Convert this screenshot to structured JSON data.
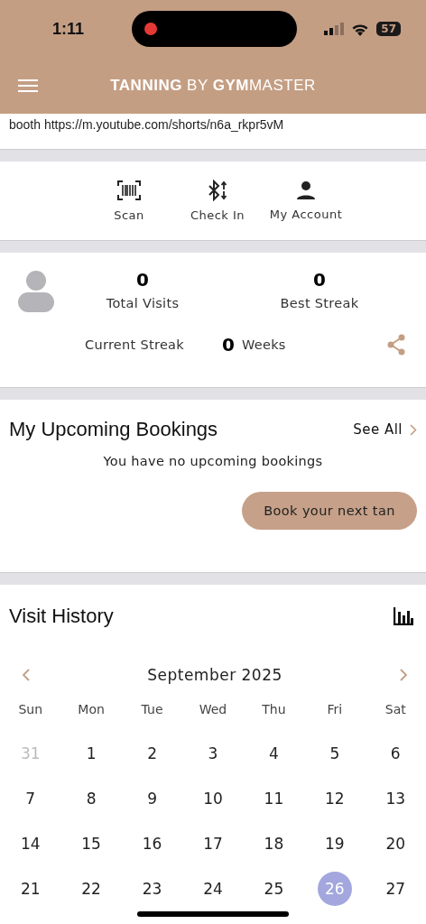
{
  "status_bar": {
    "time": "1:11",
    "battery": "57"
  },
  "header": {
    "title": "**TANNING** BY **GYM**MASTER"
  },
  "banner": {
    "text": "booth https://m.youtube.com/shorts/n6a_rkpr5vM"
  },
  "actions": [
    {
      "kind": "scan",
      "label": "Scan"
    },
    {
      "kind": "checkin",
      "label": "Check In"
    },
    {
      "kind": "account",
      "label": "My Account"
    }
  ],
  "stats": {
    "items": [
      {
        "value": "0",
        "label": "Total Visits"
      },
      {
        "value": "0",
        "label": "Best Streak"
      }
    ],
    "current_streak": {
      "label": "Current Streak",
      "value": "0",
      "unit": "Weeks"
    }
  },
  "bookings": {
    "title": "My Upcoming Bookings",
    "see_all": "See All",
    "empty": "You have no upcoming bookings",
    "button": "Book your next tan"
  },
  "visit_history": {
    "title": "Visit History",
    "month": "September 2025",
    "weekdays": [
      "Sun",
      "Mon",
      "Tue",
      "Wed",
      "Thu",
      "Fri",
      "Sat"
    ],
    "weeks": [
      [
        {
          "day": "31",
          "outside": true,
          "selected": false
        },
        {
          "day": "1",
          "outside": false,
          "selected": false
        },
        {
          "day": "2",
          "outside": false,
          "selected": false
        },
        {
          "day": "3",
          "outside": false,
          "selected": false
        },
        {
          "day": "4",
          "outside": false,
          "selected": false
        },
        {
          "day": "5",
          "outside": false,
          "selected": false
        },
        {
          "day": "6",
          "outside": false,
          "selected": false
        }
      ],
      [
        {
          "day": "7",
          "outside": false,
          "selected": false
        },
        {
          "day": "8",
          "outside": false,
          "selected": false
        },
        {
          "day": "9",
          "outside": false,
          "selected": false
        },
        {
          "day": "10",
          "outside": false,
          "selected": false
        },
        {
          "day": "11",
          "outside": false,
          "selected": false
        },
        {
          "day": "12",
          "outside": false,
          "selected": false
        },
        {
          "day": "13",
          "outside": false,
          "selected": false
        }
      ],
      [
        {
          "day": "14",
          "outside": false,
          "selected": false
        },
        {
          "day": "15",
          "outside": false,
          "selected": false
        },
        {
          "day": "16",
          "outside": false,
          "selected": false
        },
        {
          "day": "17",
          "outside": false,
          "selected": false
        },
        {
          "day": "18",
          "outside": false,
          "selected": false
        },
        {
          "day": "19",
          "outside": false,
          "selected": false
        },
        {
          "day": "20",
          "outside": false,
          "selected": false
        }
      ],
      [
        {
          "day": "21",
          "outside": false,
          "selected": false
        },
        {
          "day": "22",
          "outside": false,
          "selected": false
        },
        {
          "day": "23",
          "outside": false,
          "selected": false
        },
        {
          "day": "24",
          "outside": false,
          "selected": false
        },
        {
          "day": "25",
          "outside": false,
          "selected": false
        },
        {
          "day": "26",
          "outside": false,
          "selected": true
        },
        {
          "day": "27",
          "outside": false,
          "selected": false
        }
      ]
    ]
  }
}
